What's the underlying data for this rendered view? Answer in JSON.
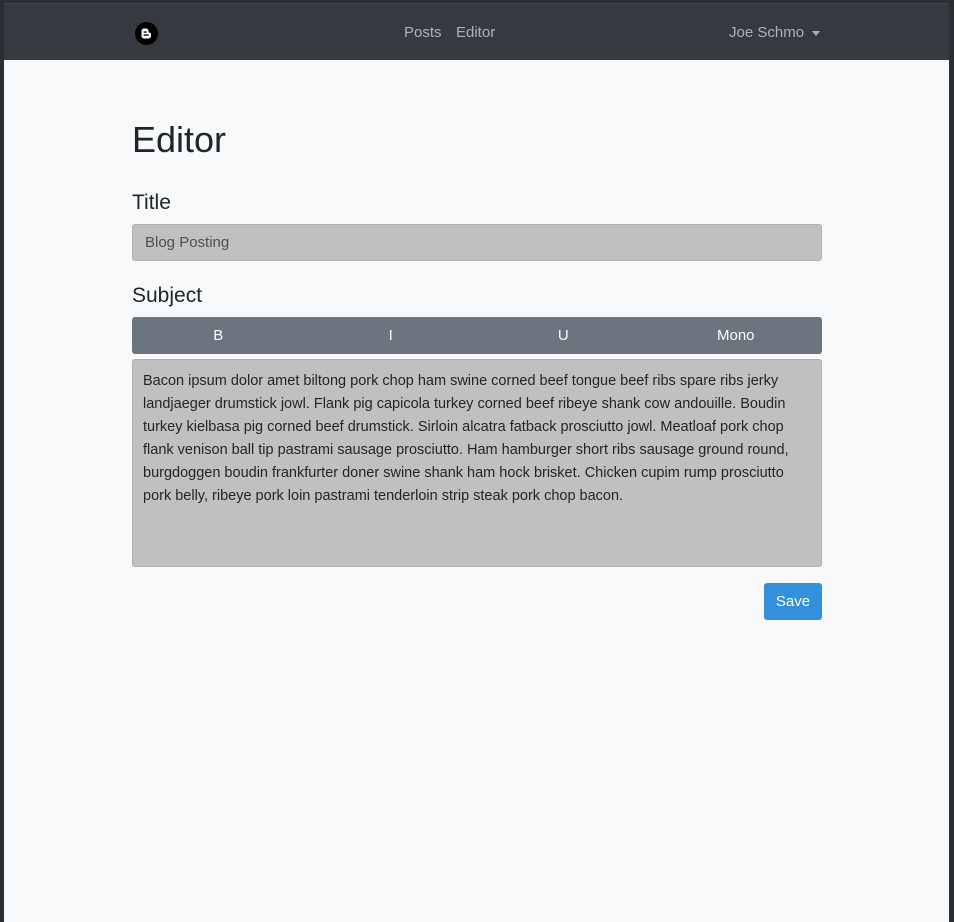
{
  "navbar": {
    "brand_icon": "blogger-icon",
    "links": [
      {
        "label": "Posts"
      },
      {
        "label": "Editor"
      }
    ],
    "user_name": "Joe Schmo"
  },
  "editor": {
    "heading": "Editor",
    "title_label": "Title",
    "title_value": "Blog Posting",
    "subject_label": "Subject",
    "format_buttons": [
      "B",
      "I",
      "U",
      "Mono"
    ],
    "subject_value": "Bacon ipsum dolor amet biltong pork chop ham swine corned beef tongue beef ribs spare ribs jerky landjaeger drumstick jowl. Flank pig capicola turkey corned beef ribeye shank cow andouille. Boudin turkey kielbasa pig corned beef drumstick. Sirloin alcatra fatback prosciutto jowl. Meatloaf pork chop flank venison ball tip pastrami sausage prosciutto. Ham hamburger short ribs sausage ground round, burgdoggen boudin frankfurter doner swine shank ham hock brisket. Chicken cupim rump prosciutto pork belly, ribeye pork loin pastrami tenderloin strip steak pork chop bacon.",
    "save_label": "Save"
  },
  "colors": {
    "navbar_bg": "#343a40",
    "page_bg": "#f8f9fa",
    "format_bar_bg": "#6c757d",
    "input_bg": "#c0c0c0",
    "primary": "#3490dc"
  }
}
